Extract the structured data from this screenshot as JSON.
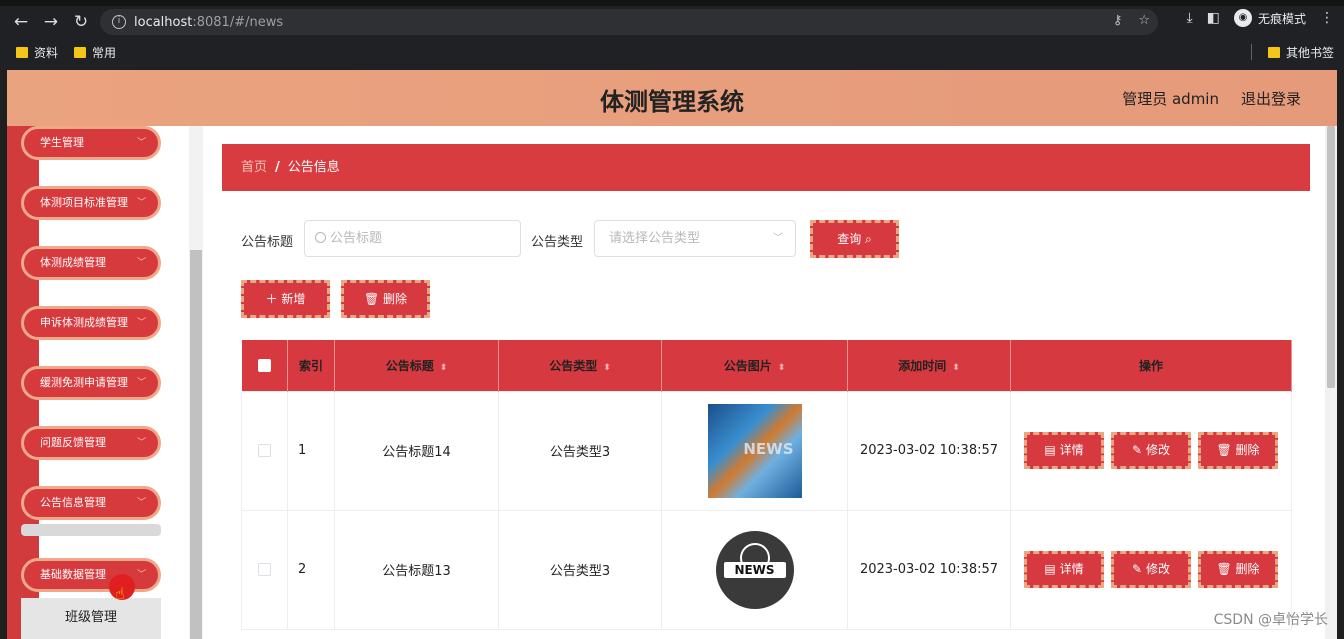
{
  "browser": {
    "url_host": "localhost",
    "url_path": ":8081/#/news",
    "incognito_label": "无痕模式",
    "bookmarks": [
      "资料",
      "常用"
    ],
    "other_bookmarks": "其他书签"
  },
  "header": {
    "title": "体测管理系统",
    "user": "管理员 admin",
    "logout": "退出登录"
  },
  "sidebar": {
    "items": [
      "学生管理",
      "体测项目标准管理",
      "体测成绩管理",
      "申诉体测成绩管理",
      "缓测免测申请管理",
      "问题反馈管理",
      "公告信息管理",
      "基础数据管理"
    ],
    "sub_item": "班级管理"
  },
  "breadcrumb": {
    "home": "首页",
    "sep": "/",
    "current": "公告信息"
  },
  "search": {
    "title_label": "公告标题",
    "title_placeholder": "公告标题",
    "type_label": "公告类型",
    "type_placeholder": "请选择公告类型",
    "query_btn": "查询"
  },
  "actions": {
    "add": "新增",
    "delete": "删除"
  },
  "table": {
    "headers": [
      "索引",
      "公告标题",
      "公告类型",
      "公告图片",
      "添加时间",
      "操作"
    ],
    "rows": [
      {
        "index": "1",
        "title": "公告标题14",
        "type": "公告类型3",
        "image": "news-image-1",
        "time": "2023-03-02 10:38:57"
      },
      {
        "index": "2",
        "title": "公告标题13",
        "type": "公告类型3",
        "image": "news-image-2",
        "time": "2023-03-02 10:38:57"
      }
    ],
    "row_actions": {
      "detail": "详情",
      "edit": "修改",
      "delete": "删除"
    },
    "image_text": {
      "img1": "NEWS",
      "img2": "NEWS"
    }
  },
  "watermark": "CSDN @卓怡学长",
  "colors": {
    "primary": "#d6393f",
    "header": "#eaa37f",
    "accent_border": "#e9a882"
  }
}
